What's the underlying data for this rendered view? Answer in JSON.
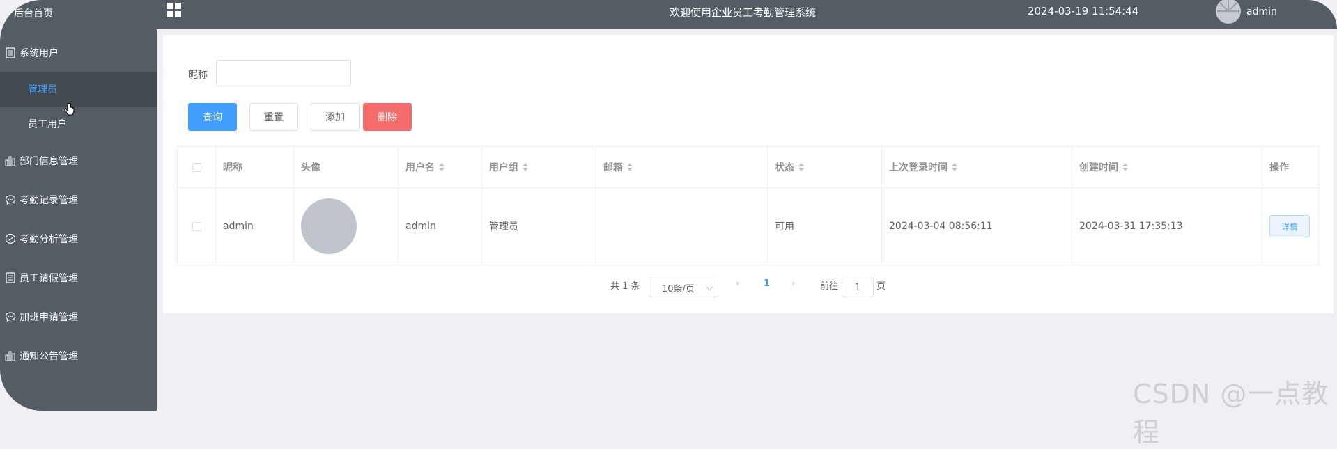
{
  "sidebar": {
    "home": "后台首页",
    "items": [
      {
        "label": "系统用户",
        "icon": "doc-icon"
      },
      {
        "label": "管理员",
        "icon": ""
      },
      {
        "label": "员工用户",
        "icon": ""
      },
      {
        "label": "部门信息管理",
        "icon": "bar-chart-icon"
      },
      {
        "label": "考勤记录管理",
        "icon": "chat-icon"
      },
      {
        "label": "考勤分析管理",
        "icon": "check-circle-icon"
      },
      {
        "label": "员工请假管理",
        "icon": "doc-icon"
      },
      {
        "label": "加班申请管理",
        "icon": "chat-icon"
      },
      {
        "label": "通知公告管理",
        "icon": "bar-chart-icon"
      }
    ]
  },
  "header": {
    "title": "欢迎使用企业员工考勤管理系统",
    "datetime": "2024-03-19 11:54:44",
    "username": "admin"
  },
  "search": {
    "label": "昵称",
    "value": "",
    "placeholder": ""
  },
  "buttons": {
    "query": "查询",
    "reset": "重置",
    "add": "添加",
    "delete": "删除"
  },
  "table": {
    "headers": [
      "昵称",
      "头像",
      "用户名",
      "用户组",
      "邮箱",
      "状态",
      "上次登录时间",
      "创建时间",
      "操作"
    ],
    "rows": [
      {
        "nickname": "admin",
        "username": "admin",
        "group": "管理员",
        "email": "",
        "status": "可用",
        "last_login": "2024-03-04 08:56:11",
        "created": "2024-03-31 17:35:13",
        "action": "详情"
      }
    ]
  },
  "pagination": {
    "total": "共 1 条",
    "page_size": "10条/页",
    "current_page": "1",
    "goto_label": "前往",
    "goto_value": "1",
    "page_suffix": "页"
  },
  "watermark": "CSDN @一点教程",
  "colors": {
    "sidebar_bg": "#545c64",
    "primary": "#409eff",
    "danger": "#f56c6c"
  }
}
